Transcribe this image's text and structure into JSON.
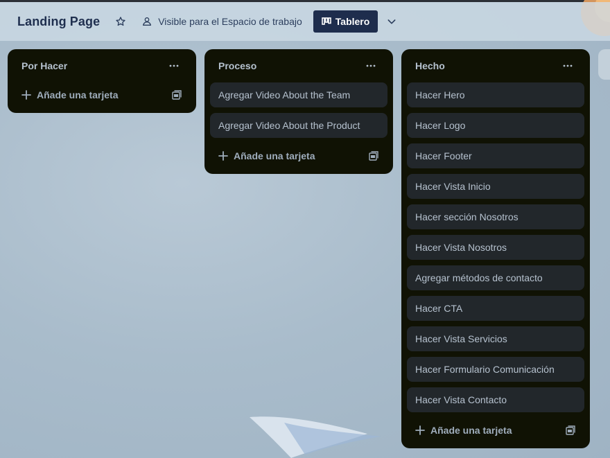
{
  "header": {
    "board_title": "Landing Page",
    "visibility_label": "Visible para el Espacio de trabajo",
    "view_label": "Tablero"
  },
  "lists": [
    {
      "title": "Por Hacer",
      "cards": [],
      "add_label": "Añade una tarjeta"
    },
    {
      "title": "Proceso",
      "cards": [
        "Agregar Video About the Team",
        "Agregar Video About the Product"
      ],
      "add_label": "Añade una tarjeta"
    },
    {
      "title": "Hecho",
      "cards": [
        "Hacer Hero",
        "Hacer Logo",
        "Hacer Footer",
        "Hacer Vista Inicio",
        "Hacer sección Nosotros",
        "Hacer Vista Nosotros",
        "Agregar métodos de contacto",
        "Hacer CTA",
        "Hacer Vista Servicios",
        "Hacer Formulario Comunicación",
        "Hacer Vista Contacto"
      ],
      "add_label": "Añade una tarjeta"
    }
  ],
  "icons": {
    "star": "star-icon",
    "visibility": "people-icon",
    "view": "board-icon",
    "chevron": "chevron-down-icon",
    "menu": "more-icon",
    "add": "plus-icon",
    "template": "template-icon"
  },
  "colors": {
    "list_bg": "#101204",
    "card_bg": "#22272b",
    "card_text": "#b6c2cf",
    "header_title": "#1f2f4f",
    "view_button_bg": "#1e2d4d"
  }
}
